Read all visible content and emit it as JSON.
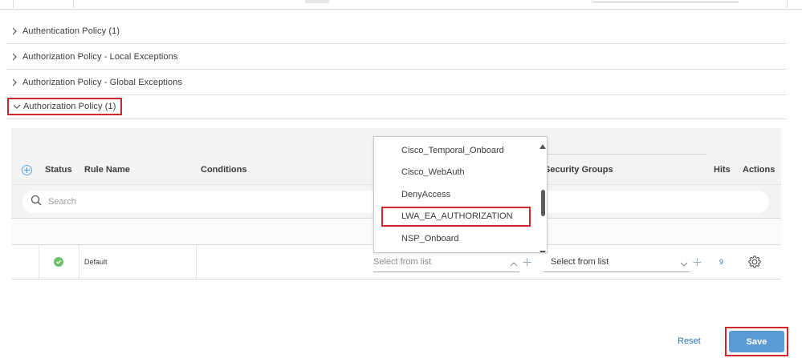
{
  "policies": [
    {
      "label": "Authentication Policy (1)",
      "expanded": false
    },
    {
      "label": "Authorization Policy - Local Exceptions",
      "expanded": false
    },
    {
      "label": "Authorization Policy - Global Exceptions",
      "expanded": false
    },
    {
      "label": "Authorization Policy (1)",
      "expanded": true
    }
  ],
  "table": {
    "headers": {
      "status": "Status",
      "rule_name": "Rule Name",
      "conditions": "Conditions",
      "security_groups": "Security Groups",
      "hits": "Hits",
      "actions": "Actions"
    },
    "search_placeholder": "Search",
    "rows": [
      {
        "status": "enabled",
        "rule_name": "Default",
        "profiles_value": "Select from list",
        "security_groups_value": "Select from list",
        "hits": "9"
      }
    ]
  },
  "dropdown": {
    "options": [
      "Cisco_Temporal_Onboard",
      "Cisco_WebAuth",
      "DenyAccess",
      "LWA_EA_AUTHORIZATION",
      "NSP_Onboard"
    ],
    "highlighted": "LWA_EA_AUTHORIZATION"
  },
  "footer": {
    "reset_label": "Reset",
    "save_label": "Save"
  },
  "colors": {
    "highlight_border": "#d0272d",
    "accent": "#5b9bd5",
    "link": "#2e74b5",
    "status_ok": "#6abf69"
  },
  "icons": {
    "collapsed": "chevron-right-icon",
    "expanded": "chevron-down-icon",
    "add": "add-circle-icon",
    "search": "search-icon",
    "status": "check-circle-icon",
    "actions": "gear-icon"
  }
}
